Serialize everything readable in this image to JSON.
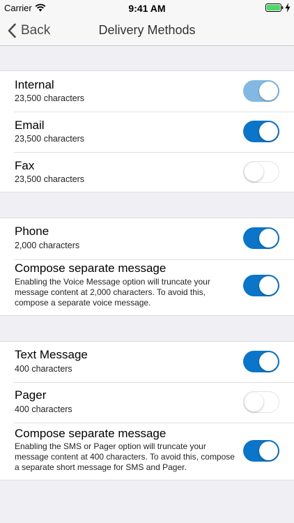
{
  "status_bar": {
    "carrier": "Carrier",
    "time": "9:41 AM",
    "icons": [
      "wifi-icon",
      "battery-icon",
      "charging-bolt-icon"
    ],
    "battery_color": "#4cd964"
  },
  "nav": {
    "back_label": "Back",
    "title": "Delivery Methods"
  },
  "colors": {
    "toggle_on": "#0a75c9",
    "toggle_on_disabled": "#82b8e2",
    "background": "#efeff4"
  },
  "groups": [
    {
      "rows": [
        {
          "title": "Internal",
          "subtitle": "23,500 characters",
          "toggle": "on-disabled"
        },
        {
          "title": "Email",
          "subtitle": "23,500 characters",
          "toggle": "on"
        },
        {
          "title": "Fax",
          "subtitle": "23,500 characters",
          "toggle": "off"
        }
      ]
    },
    {
      "rows": [
        {
          "title": "Phone",
          "subtitle": "2,000 characters",
          "toggle": "on"
        },
        {
          "title": "Compose separate message",
          "description": "Enabling the Voice Message option will truncate your message content at 2,000 characters. To avoid this, compose a separate voice message.",
          "toggle": "on"
        }
      ]
    },
    {
      "rows": [
        {
          "title": "Text Message",
          "subtitle": "400 characters",
          "toggle": "on"
        },
        {
          "title": "Pager",
          "subtitle": "400 characters",
          "toggle": "off"
        },
        {
          "title": "Compose separate message",
          "description": "Enabling the SMS or Pager option will truncate your message content at 400 characters. To avoid this, compose a separate short message for SMS and Pager.",
          "toggle": "on"
        }
      ]
    }
  ]
}
